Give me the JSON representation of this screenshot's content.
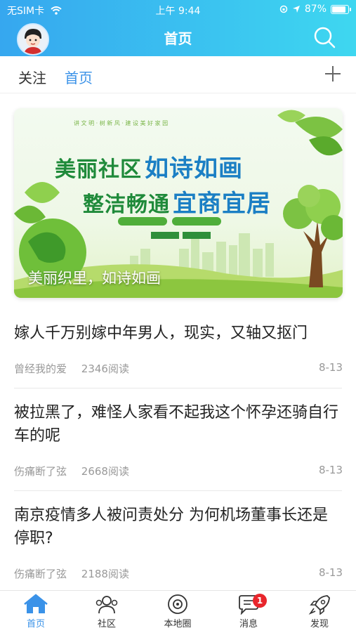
{
  "status_bar": {
    "carrier": "无SIM卡",
    "time": "上午 9:44",
    "battery": "87%"
  },
  "header": {
    "title": "首页"
  },
  "tabs": {
    "follow": "关注",
    "home": "首页"
  },
  "banner": {
    "headline_1": "美丽社区",
    "headline_1b": "如诗如画",
    "headline_2": "整洁畅通",
    "headline_2b": "宜商宜居",
    "caption": "美丽织里，如诗如画"
  },
  "news": [
    {
      "title": "嫁人千万别嫁中年男人，现实，又轴又抠门",
      "author": "曾经我的爱",
      "reads": "2346阅读",
      "date": "8-13"
    },
    {
      "title": "被拉黑了，难怪人家看不起我这个怀孕还骑自行车的呢",
      "author": "伤痛断了弦",
      "reads": "2668阅读",
      "date": "8-13"
    },
    {
      "title": "南京疫情多人被问责处分 为何机场董事长还是停职?",
      "author": "伤痛断了弦",
      "reads": "2188阅读",
      "date": "8-13"
    }
  ],
  "tabbar": [
    {
      "label": "首页",
      "icon": "home-icon"
    },
    {
      "label": "社区",
      "icon": "community-icon"
    },
    {
      "label": "本地圈",
      "icon": "local-circle-icon"
    },
    {
      "label": "消息",
      "icon": "message-icon",
      "badge": "1"
    },
    {
      "label": "发现",
      "icon": "rocket-icon"
    }
  ],
  "colors": {
    "accent": "#3a92e8",
    "header_start": "#36a7ef",
    "header_end": "#3ed7f0",
    "badge": "#e8262c"
  }
}
